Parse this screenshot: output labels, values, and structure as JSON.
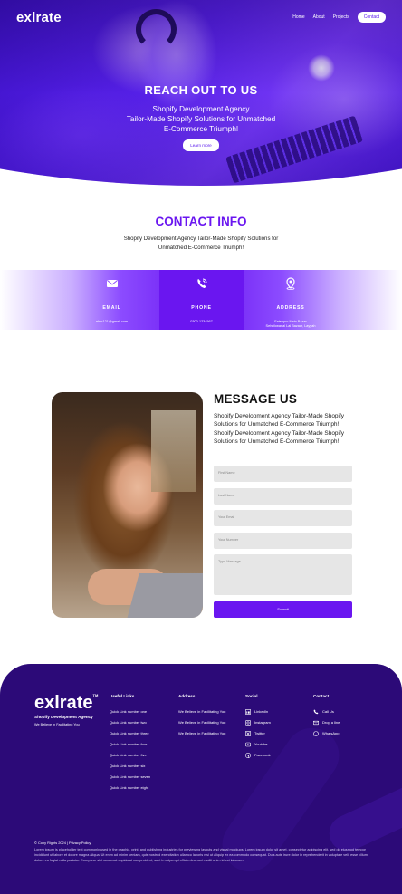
{
  "brand": {
    "name": "exlrate"
  },
  "nav": {
    "links": [
      "Home",
      "About",
      "Projects"
    ],
    "contact_btn": "Contact"
  },
  "hero": {
    "title": "REACH OUT TO US",
    "line1": "Shopify Development Agency",
    "line2": "Tailor-Made Shopify Solutions for Unmatched",
    "line3": "E-Commerce Triumph!",
    "button": "Learn more"
  },
  "contact_info": {
    "title": "CONTACT INFO",
    "subtitle_line1": "Shopify Development Agency Tailor-Made Shopify Solutions for",
    "subtitle_line2": "Unmatched E-Commerce Triumph!",
    "cards": [
      {
        "label": "EMAIL",
        "value1": "ehor121@gmail.com",
        "value2": "",
        "icon": "mail-icon"
      },
      {
        "label": "PHONE",
        "value1": "0300-1234567",
        "value2": "",
        "icon": "phone-icon"
      },
      {
        "label": "ADDRESS",
        "value1": "Fatehpur Main Bazar",
        "value2": "Seheikwanal Lal Bazaar, Layyah",
        "icon": "location-icon"
      }
    ]
  },
  "message": {
    "title": "MESSAGE US",
    "text": "Shopify Development Agency Tailor-Made Shopify Solutions for Unmatched E-Commerce Triumph! Shopify Development Agency Tailor-Made Shopify Solutions for Unmatched E-Commerce Triumph!",
    "fields": [
      "First Name",
      "Last Name",
      "Your Email",
      "Your Number",
      "Type Message"
    ],
    "submit": "Submit"
  },
  "footer": {
    "logo": "exlrate",
    "tm": "TM",
    "agency": "Shopify Development Agency",
    "believe": "We Believe in Facilitating You",
    "useful_links": {
      "title": "Useful Links",
      "items": [
        "Quick Link number one",
        "Quick Link number two",
        "Quick Link number three",
        "Quick Link number four",
        "Quick Link number five",
        "Quick Link number six",
        "Quick Link number seven",
        "Quick Link number eight"
      ]
    },
    "address": {
      "title": "Address",
      "items": [
        "We Believe in Facilitating You",
        "We Believe in Facilitating You",
        "We Believe in Facilitating You"
      ]
    },
    "social": {
      "title": "Social",
      "items": [
        "LinkedIn",
        "Instagram",
        "Twitter",
        "Youtube",
        "Facebook"
      ]
    },
    "contact": {
      "title": "Contact",
      "items": [
        "Call Us",
        "Drop a line",
        "WhatsApp"
      ]
    },
    "copyright": "© Copy Rights 2024 | Privacy Policy",
    "lorem": "Lorem ipsum is placeholder text commonly used in the graphic, print, and publishing industries for previewing layouts and visual mockups. Lorem ipsum dolor sit amet, consectetur adipiscing elit, sed do eiusmod tempor incididunt ut labore et dolore magna aliqua. Ut enim ad minim veniam, quis nostrud exercitation ullamco laboris nisi ut aliquip ex ea commodo consequat. Duis aute irure dolor in reprehenderit in voluptate velit esse cillum dolore eu fugiat nulla pariatur. Excepteur sint occaecat cupidatat non proident, sunt in culpa qui officia deserunt mollit anim id est laborum."
  },
  "colors": {
    "accent": "#6a16f0",
    "footer_bg": "#2c0a78"
  }
}
